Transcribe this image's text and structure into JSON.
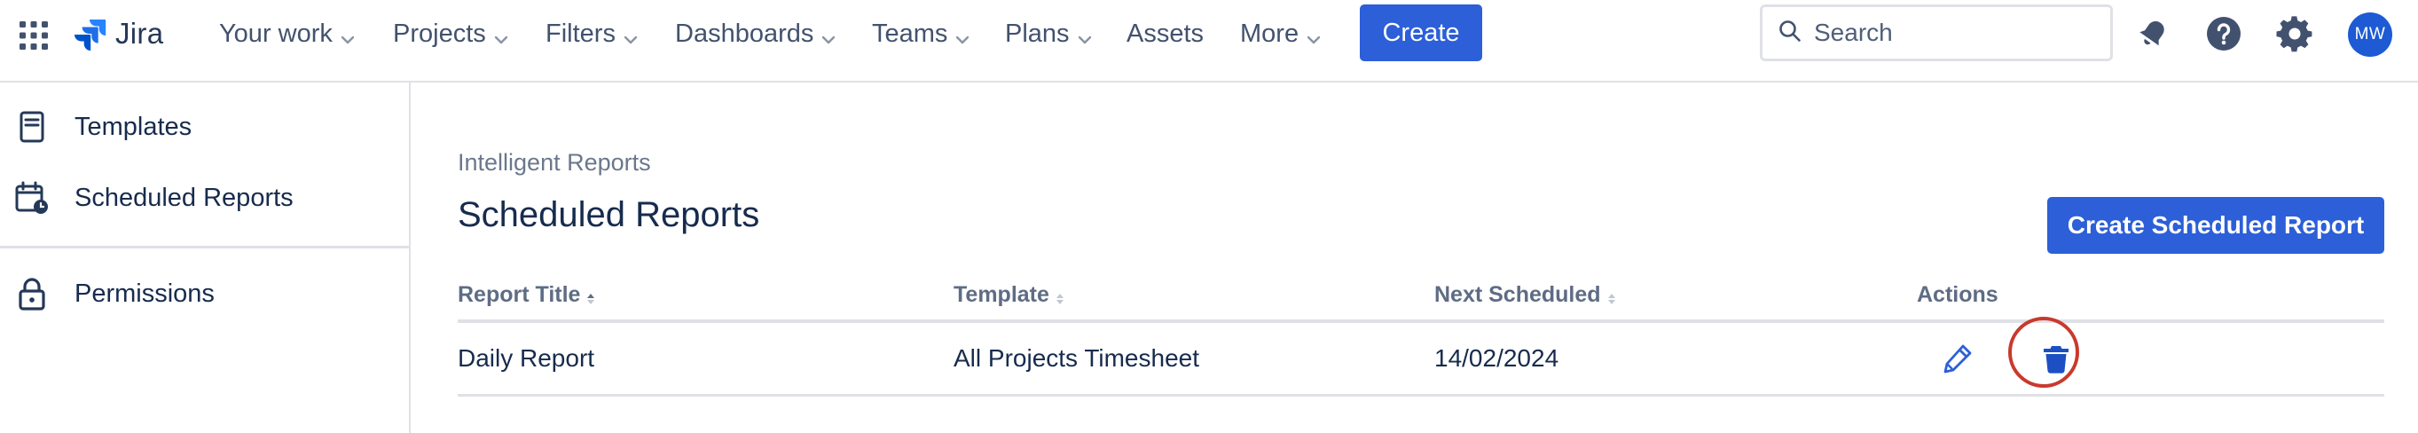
{
  "topnav": {
    "app_name": "Jira",
    "items": [
      {
        "label": "Your work",
        "has_dropdown": true
      },
      {
        "label": "Projects",
        "has_dropdown": true
      },
      {
        "label": "Filters",
        "has_dropdown": true
      },
      {
        "label": "Dashboards",
        "has_dropdown": true
      },
      {
        "label": "Teams",
        "has_dropdown": true
      },
      {
        "label": "Plans",
        "has_dropdown": true
      },
      {
        "label": "Assets",
        "has_dropdown": false
      },
      {
        "label": "More",
        "has_dropdown": true
      }
    ],
    "create_label": "Create",
    "search": {
      "placeholder": "Search",
      "value": ""
    },
    "icons": [
      "notifications-icon",
      "help-icon",
      "settings-icon"
    ],
    "avatar_initials": "MW",
    "colors": {
      "primary": "#2c5fd8",
      "avatar": "#1d5ad4",
      "danger_ring": "#c83a2c"
    }
  },
  "sidebar": {
    "items": [
      {
        "label": "Templates",
        "icon": "template-icon"
      },
      {
        "label": "Scheduled Reports",
        "icon": "calendar-icon"
      },
      {
        "label": "Permissions",
        "icon": "lock-icon"
      }
    ]
  },
  "main": {
    "breadcrumb": "Intelligent Reports",
    "title": "Scheduled Reports",
    "primary_action": "Create Scheduled Report",
    "table": {
      "columns": [
        "Report Title",
        "Template",
        "Next Scheduled",
        "Actions"
      ],
      "sorted_column": "Report Title",
      "sort_direction": "ascending",
      "rows": [
        {
          "title": "Daily Report",
          "template": "All Projects Timesheet",
          "next_scheduled": "14/02/2024",
          "actions": [
            "edit-icon",
            "delete-icon"
          ]
        }
      ]
    }
  }
}
